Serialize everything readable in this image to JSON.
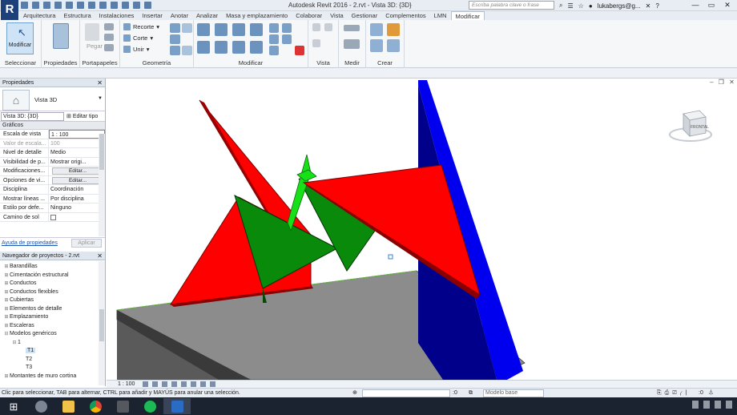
{
  "titlebar": {
    "logo_letter": "R",
    "title": "Autodesk Revit 2016 -    2.rvt - Vista 3D: {3D}",
    "search_placeholder": "Escriba palabra clave o frase",
    "user": "lukabergs@g...",
    "window_controls": [
      "minimize-icon",
      "maximize-icon",
      "close-icon"
    ]
  },
  "tabs": [
    "Arquitectura",
    "Estructura",
    "Instalaciones",
    "Insertar",
    "Anotar",
    "Analizar",
    "Masa y emplazamiento",
    "Colaborar",
    "Vista",
    "Gestionar",
    "Complementos",
    "LMN",
    "Modificar"
  ],
  "active_tab": "Modificar",
  "ribbon": {
    "modify_label": "Modificar",
    "cut_label": "Recorte",
    "corte_label": "Corte",
    "unir_label": "Unir",
    "pegar_label": "Pegar",
    "panels": [
      "Seleccionar",
      "Propiedades",
      "Portapapeles",
      "Geometría",
      "Modificar",
      "Vista",
      "Medir",
      "Crear"
    ]
  },
  "properties": {
    "header": "Propiedades",
    "type_name": "Vista 3D",
    "instance_selector": "Vista 3D: {3D}",
    "edit_type": "Editar tipo",
    "category": "Gráficos",
    "rows": [
      {
        "k": "Escala de vista",
        "v": "1 : 100",
        "dim": false
      },
      {
        "k": "Valor de escala...",
        "v": "100",
        "dim": true
      },
      {
        "k": "Nivel de detalle",
        "v": "Medio",
        "dim": false
      },
      {
        "k": "Visibilidad de p...",
        "v": "Mostrar origi...",
        "dim": false
      },
      {
        "k": "Modificaciones...",
        "v": "Editar...",
        "dim": false,
        "button": true
      },
      {
        "k": "Opciones de vi...",
        "v": "Editar...",
        "dim": false,
        "button": true
      },
      {
        "k": "Disciplina",
        "v": "Coordinación",
        "dim": false
      },
      {
        "k": "Mostrar líneas ...",
        "v": "Por disciplina",
        "dim": false
      },
      {
        "k": "Estilo por defe...",
        "v": "Ninguno",
        "dim": false
      },
      {
        "k": "Camino de sol",
        "v": "",
        "dim": false,
        "checkbox": true
      }
    ],
    "help_link": "Ayuda de propiedades",
    "apply": "Aplicar"
  },
  "browser": {
    "header": "Navegador de proyectos - 2.rvt",
    "items": [
      {
        "label": "Barandillas",
        "depth": 1,
        "toggle": "+"
      },
      {
        "label": "Cimentación estructural",
        "depth": 1,
        "toggle": "+"
      },
      {
        "label": "Conductos",
        "depth": 1,
        "toggle": "+"
      },
      {
        "label": "Conductos flexibles",
        "depth": 1,
        "toggle": "+"
      },
      {
        "label": "Cubiertas",
        "depth": 1,
        "toggle": "+"
      },
      {
        "label": "Elementos de detalle",
        "depth": 1,
        "toggle": "+"
      },
      {
        "label": "Emplazamiento",
        "depth": 1,
        "toggle": "+"
      },
      {
        "label": "Escaleras",
        "depth": 1,
        "toggle": "+"
      },
      {
        "label": "Modelos genéricos",
        "depth": 1,
        "toggle": "−"
      },
      {
        "label": "1",
        "depth": 2,
        "toggle": "−"
      },
      {
        "label": "T1",
        "depth": 3,
        "toggle": "",
        "selected": true
      },
      {
        "label": "T2",
        "depth": 3,
        "toggle": ""
      },
      {
        "label": "T3",
        "depth": 3,
        "toggle": ""
      },
      {
        "label": "Montantes de muro cortina",
        "depth": 1,
        "toggle": "+"
      }
    ]
  },
  "viewcube": {
    "face": "FRONTAL"
  },
  "view_bar": {
    "scale": "1 : 100"
  },
  "status": {
    "text": "Clic para seleccionar, TAB para alternar, CTRL para añadir y MAYÚS para anular una selección.",
    "workset_value": ":0",
    "model": "Modelo base",
    "filter_count": ":0"
  },
  "colors": {
    "red": "#ff0000",
    "green": "#0a8f0a",
    "bright_green": "#18e018",
    "blue": "#0000ff",
    "slab": "#8a8a8a"
  }
}
